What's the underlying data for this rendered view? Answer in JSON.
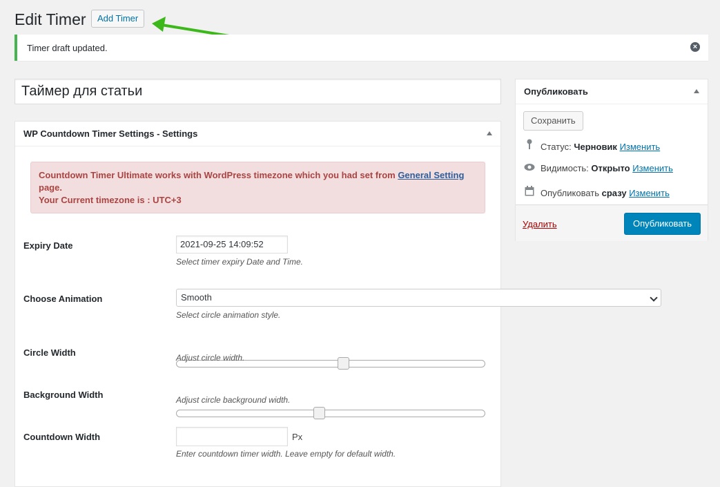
{
  "header": {
    "title": "Edit Timer",
    "add_button": "Add Timer"
  },
  "notice": {
    "text": "Timer draft updated.",
    "close_icon": "close-circle-icon",
    "accent_color": "#46b450"
  },
  "post_title": "Таймер для статьи",
  "settings": {
    "title": "WP Countdown Timer Settings - Settings",
    "warning": {
      "line1_prefix": "Countdown Timer Ultimate works with WordPress timezone which you had set from ",
      "link_text": "General Setting",
      "line1_suffix": "page.",
      "line2": "Your Current timezone is : UTC+3"
    },
    "rows": {
      "expiry": {
        "label": "Expiry Date",
        "value": "2021-09-25 14:09:52",
        "description": "Select timer expiry Date and Time."
      },
      "animation": {
        "label": "Choose Animation",
        "selected": "Smooth",
        "description": "Select circle animation style."
      },
      "circle_width": {
        "label": "Circle Width",
        "level": 0.54,
        "description": "Adjust circle width."
      },
      "background_width": {
        "label": "Background Width",
        "level": 0.46,
        "description": "Adjust circle background width."
      },
      "countdown_width": {
        "label": "Countdown Width",
        "value": "",
        "unit": "Px",
        "description": "Enter countdown timer width. Leave empty for default width."
      }
    }
  },
  "publish": {
    "title": "Опубликовать",
    "save_button": "Сохранить",
    "status_label": "Статус:",
    "status_value": "Черновик",
    "visibility_label": "Видимость:",
    "visibility_value": "Открыто",
    "schedule_label": "Опубликовать",
    "schedule_value": "сразу",
    "edit_link": "Изменить",
    "delete_link": "Удалить",
    "publish_button": "Опубликовать",
    "primary_color": "#0085ba"
  }
}
